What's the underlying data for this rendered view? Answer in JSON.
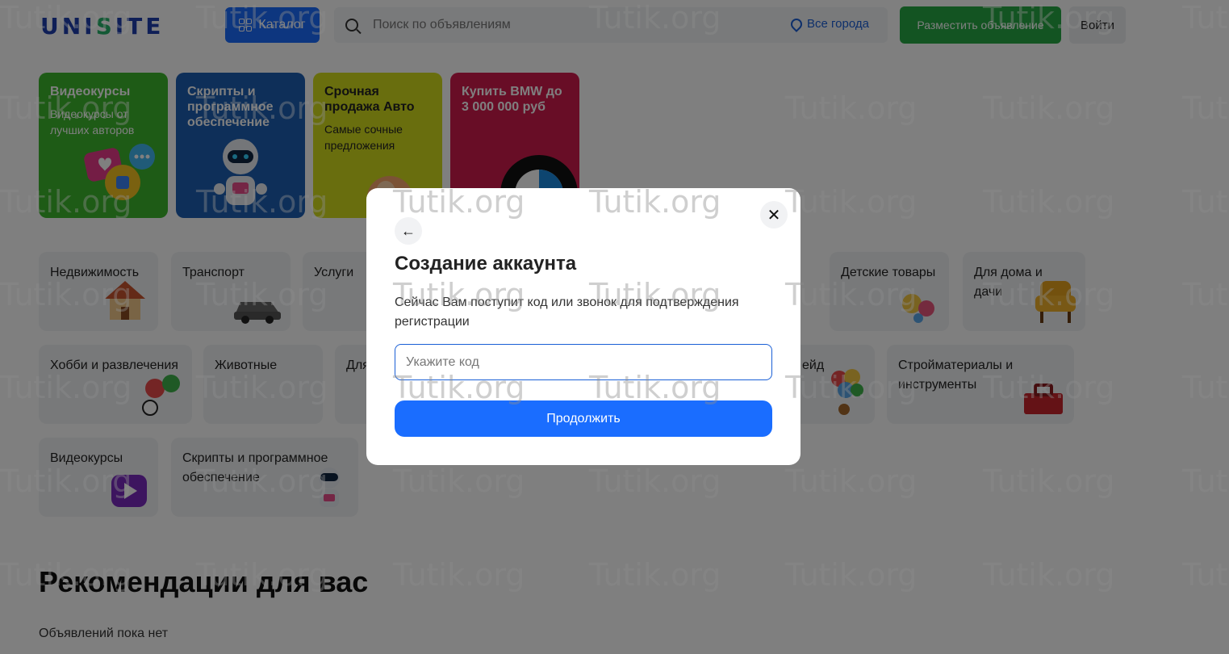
{
  "header": {
    "logo": "UNISITE",
    "catalog_label": "Каталог",
    "search_placeholder": "Поиск по объявлениям",
    "city_label": "Все города",
    "post_label": "Разместить объявление",
    "login_label": "Войти"
  },
  "promos": [
    {
      "title": "Видеокурсы",
      "desc": "Видеокурсы от лучших авторов",
      "color": "#3cb72d"
    },
    {
      "title": "Скрипты и программное обеспечение",
      "desc": "",
      "color": "#1d5fb3"
    },
    {
      "title": "Срочная продажа Авто",
      "desc": "Самые сочные предложения",
      "color": "#d3dc1d"
    },
    {
      "title": "Купить BMW до 3 000 000 руб",
      "desc": "",
      "color": "#d11b4c"
    }
  ],
  "categories": {
    "row1": [
      "Недвижимость",
      "Транспорт",
      "Услуги",
      "Детские товары",
      "Для дома и дачи"
    ],
    "row2": [
      "Хобби и развлечения",
      "Животные",
      "Для",
      "ейд",
      "Стройматериалы и инструменты"
    ],
    "row3": [
      "Видеокурсы",
      "Скрипты и программное обеспечение"
    ]
  },
  "recommendations_title": "Рекомендации для вас",
  "no_ads_text": "Объявлений пока нет",
  "modal": {
    "title": "Создание аккаунта",
    "text": "Сейчас Вам поступит код или звонок для подтверждения регистрации",
    "code_placeholder": "Укажите код",
    "continue_label": "Продолжить"
  },
  "watermark": "Tutik.org",
  "colors": {
    "accent": "#1a6dff",
    "post_button": "#27a844"
  }
}
